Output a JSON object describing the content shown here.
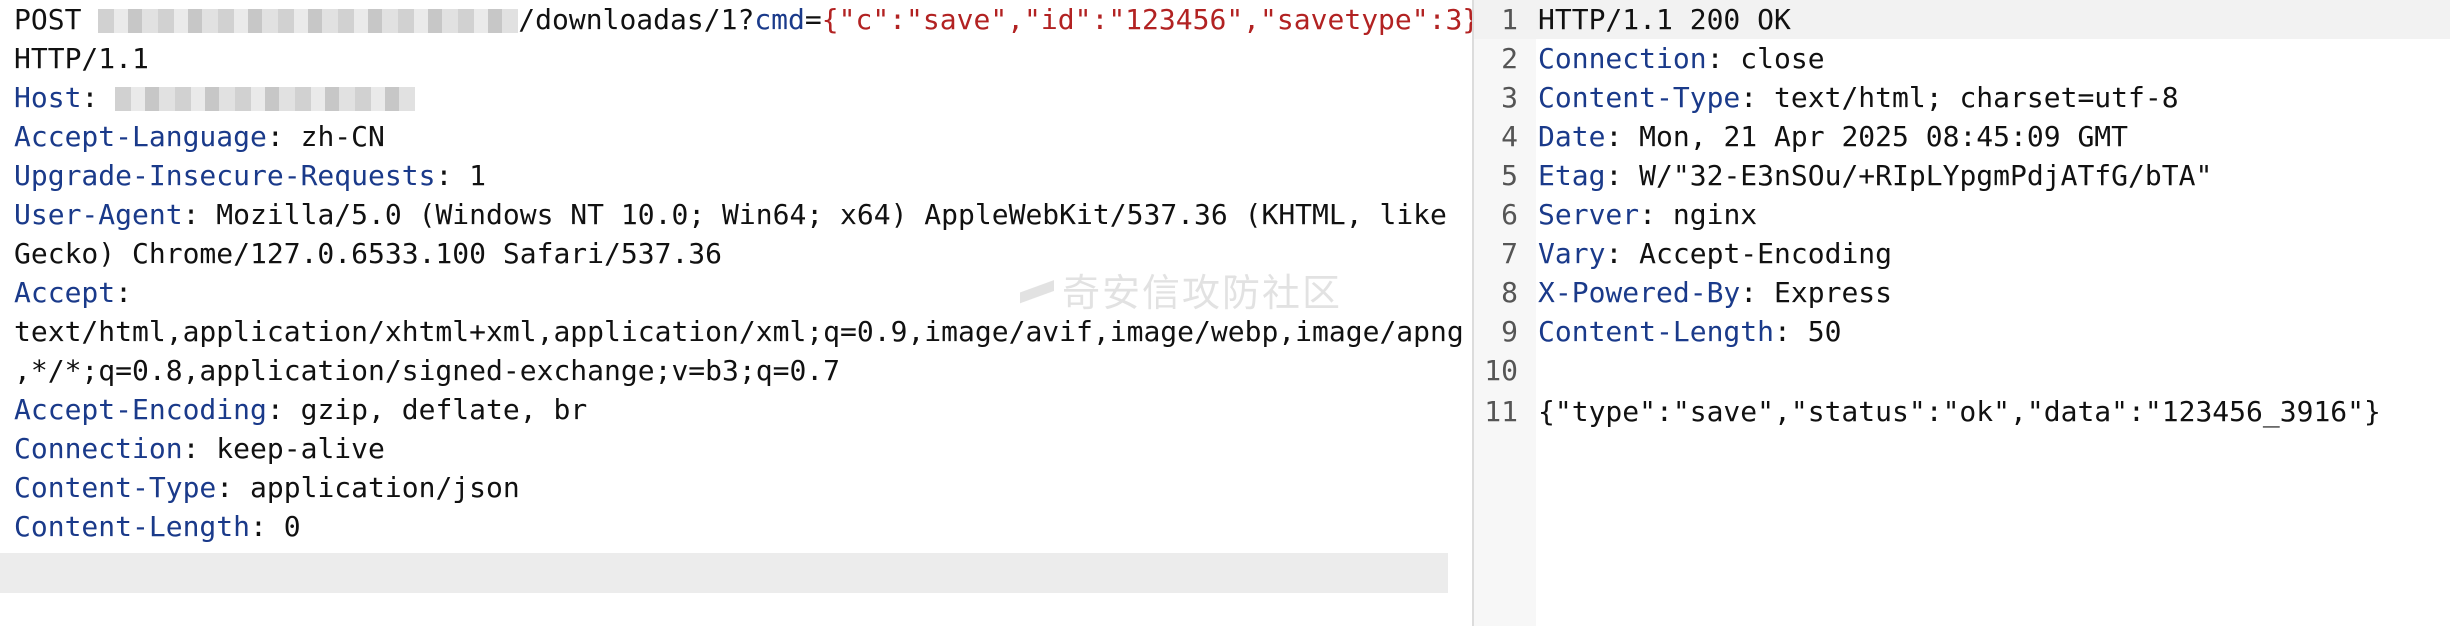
{
  "request": {
    "method": "POST",
    "path_suffix": "/downloadas/1?",
    "query_param": "cmd",
    "equals": "=",
    "query_value": "{\"c\":\"save\",\"id\":\"123456\",\"savetype\":3}",
    "protocol": " HTTP/1.1",
    "headers": [
      {
        "name": "Host",
        "value": ""
      },
      {
        "name": "Accept-Language",
        "value": "zh-CN"
      },
      {
        "name": "Upgrade-Insecure-Requests",
        "value": "1"
      },
      {
        "name": "User-Agent",
        "value": "Mozilla/5.0 (Windows NT 10.0; Win64; x64) AppleWebKit/537.36 (KHTML, like Gecko) Chrome/127.0.6533.100 Safari/537.36"
      },
      {
        "name": "Accept",
        "value": "text/html,application/xhtml+xml,application/xml;q=0.9,image/avif,image/webp,image/apng,*/*;q=0.8,application/signed-exchange;v=b3;q=0.7"
      },
      {
        "name": "Accept-Encoding",
        "value": "gzip, deflate, br"
      },
      {
        "name": "Connection",
        "value": "keep-alive"
      },
      {
        "name": "Content-Type",
        "value": "application/json"
      },
      {
        "name": "Content-Length",
        "value": "0"
      }
    ]
  },
  "response": {
    "line_numbers": [
      "1",
      "2",
      "3",
      "4",
      "5",
      "6",
      "7",
      "8",
      "9",
      "10",
      "11"
    ],
    "status_line": "HTTP/1.1 200 OK",
    "headers": [
      {
        "name": "Connection",
        "value": "close"
      },
      {
        "name": "Content-Type",
        "value": "text/html; charset=utf-8"
      },
      {
        "name": "Date",
        "value": "Mon, 21 Apr 2025 08:45:09 GMT"
      },
      {
        "name": "Etag",
        "value": "W/\"32-E3nSOu/+RIpLYpgmPdjATfG/bTA\""
      },
      {
        "name": "Server",
        "value": "nginx"
      },
      {
        "name": "Vary",
        "value": "Accept-Encoding"
      },
      {
        "name": "X-Powered-By",
        "value": "Express"
      },
      {
        "name": "Content-Length",
        "value": "50"
      }
    ],
    "body": "{\"type\":\"save\",\"status\":\"ok\",\"data\":\"123456_3916\"}"
  },
  "watermark": "奇安信攻防社区",
  "colors": {
    "header_name": "#1a3a8a",
    "query_value": "#b22222",
    "divider": "#dcdcdc",
    "highlight_row": "#f2f2f2"
  }
}
